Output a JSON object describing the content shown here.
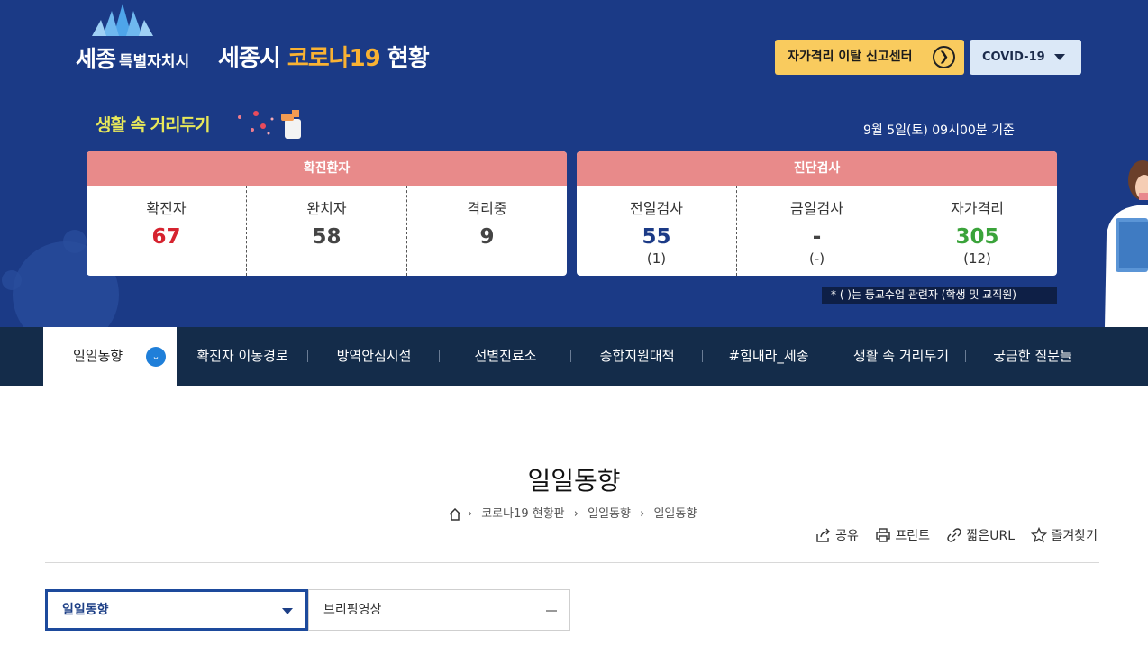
{
  "header": {
    "logo_text": "세종",
    "logo_sub": "특별자치시",
    "title_part1": "세종시 ",
    "title_highlight": "코로나19",
    "title_part2": " 현황",
    "report_button": "자가격리 이탈 신고센터",
    "covid_select": "COVID-19"
  },
  "banner": {
    "distancing_label": "생활 속 거리두기",
    "date_text": "9월 5일(토) 09시00분 기준",
    "confirmed_panel": {
      "title": "확진환자",
      "cells": [
        {
          "label": "확진자",
          "value": "67",
          "color": "#d6232f"
        },
        {
          "label": "완치자",
          "value": "58",
          "color": "#444444"
        },
        {
          "label": "격리중",
          "value": "9",
          "color": "#444444"
        }
      ]
    },
    "test_panel": {
      "title": "진단검사",
      "cells": [
        {
          "label": "전일검사",
          "value": "55",
          "sub": "(1)",
          "color": "#1b3a86"
        },
        {
          "label": "금일검사",
          "value": "-",
          "sub": "(-)",
          "color": "#444444"
        },
        {
          "label": "자가격리",
          "value": "305",
          "sub": "(12)",
          "color": "#3aa33a"
        }
      ]
    },
    "note": "* ( )는 등교수업 관련자 (학생 및 교직원)"
  },
  "nav": {
    "items": [
      "일일동향",
      "확진자 이동경로",
      "방역안심시설",
      "선별진료소",
      "종합지원대책",
      "#힘내라_세종",
      "생활 속 거리두기",
      "궁금한 질문들"
    ]
  },
  "content": {
    "page_title": "일일동향",
    "breadcrumb": [
      "코로나19 현황판",
      "일일동향",
      "일일동향"
    ],
    "tools": {
      "share": "공유",
      "print": "프린트",
      "short_url": "짧은URL",
      "favorite": "즐겨찾기"
    },
    "sub_select": "일일동향",
    "sub_tab": "브리핑영상"
  },
  "colors": {
    "banner_bg": "#1b3a86",
    "panel_head": "#e88a8a",
    "nav_bg": "#142c4a",
    "accent_yellow": "#f9cb5e"
  }
}
